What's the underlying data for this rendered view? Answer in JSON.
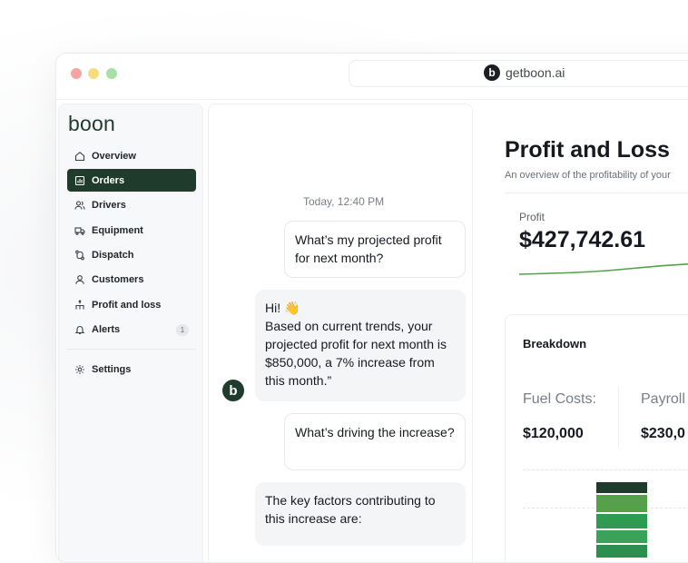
{
  "browser": {
    "url": "getboon.ai",
    "favicon_letter": "b"
  },
  "sidebar": {
    "brand": "boon",
    "items": [
      {
        "label": "Overview",
        "icon": "home-icon",
        "active": false
      },
      {
        "label": "Orders",
        "icon": "bar-chart-icon",
        "active": true
      },
      {
        "label": "Drivers",
        "icon": "users-icon",
        "active": false
      },
      {
        "label": "Equipment",
        "icon": "truck-icon",
        "active": false
      },
      {
        "label": "Dispatch",
        "icon": "route-icon",
        "active": false
      },
      {
        "label": "Customers",
        "icon": "user-icon",
        "active": false
      },
      {
        "label": "Profit and loss",
        "icon": "network-icon",
        "active": false
      },
      {
        "label": "Alerts",
        "icon": "bell-icon",
        "active": false,
        "badge": "1"
      }
    ],
    "settings": {
      "label": "Settings",
      "icon": "gear-icon"
    }
  },
  "chat": {
    "timestamp": "Today, 12:40 PM",
    "bot_avatar_letter": "b",
    "messages": [
      {
        "from": "user",
        "text": "What’s my projected profit for next month?"
      },
      {
        "from": "bot",
        "text": "Hi! 👋\nBased on current trends, your projected profit for next month is $850,000, a 7% increase from this month.”"
      },
      {
        "from": "user",
        "text": "What’s driving the increase?"
      },
      {
        "from": "bot",
        "text": "The key factors contributing to this increase are:"
      }
    ]
  },
  "report": {
    "title": "Profit and Loss",
    "subtitle": "An overview of the profitability of your",
    "profit_label": "Profit",
    "profit_value": "$427,742.61",
    "breakdown": {
      "title": "Breakdown",
      "columns": [
        {
          "label": "Fuel Costs:",
          "value": "$120,000"
        },
        {
          "label": "Payroll",
          "value": "$230,0"
        }
      ],
      "stack_colors": [
        "#1f3b2c",
        "#55a04a",
        "#2f9a52",
        "#3aa35a",
        "#2d8f4d"
      ]
    }
  },
  "colors": {
    "brand_dark": "#1f3b2c",
    "accent_green": "#55a04a"
  }
}
